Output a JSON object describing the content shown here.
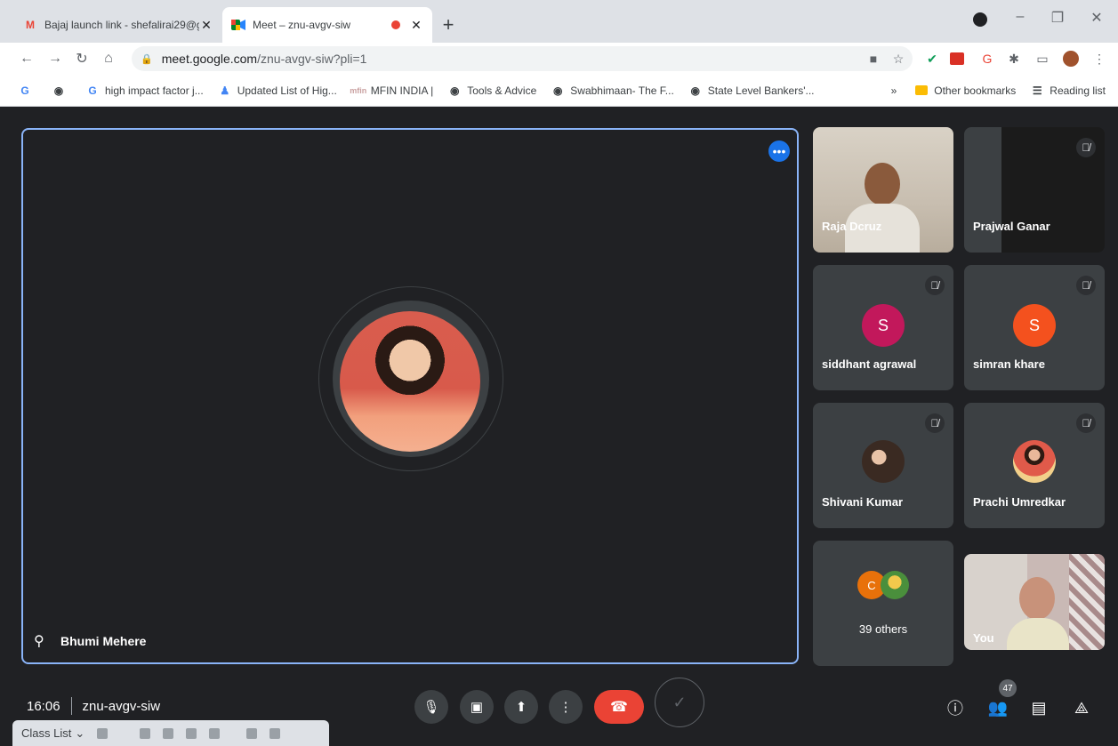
{
  "browser": {
    "tabs": [
      {
        "title": "Bajaj launch link - shefalirai29@g",
        "favicon": "gmail-icon",
        "close": "✕"
      },
      {
        "title": "Meet – znu-avgv-siw",
        "favicon": "meet-icon",
        "close": "✕"
      }
    ],
    "new_tab": "+",
    "url_host": "meet.google.com",
    "url_path": "/znu-avgv-siw?pli=1",
    "bookmarks": [
      {
        "label": "",
        "icon": "google-icon"
      },
      {
        "label": "",
        "icon": "globe-icon"
      },
      {
        "label": "high impact factor j...",
        "icon": "google-icon"
      },
      {
        "label": "Updated List of Hig...",
        "icon": "person-icon"
      },
      {
        "label": "MFIN INDIA |",
        "icon": "mfin-icon"
      },
      {
        "label": "Tools & Advice",
        "icon": "globe-icon"
      },
      {
        "label": "Swabhimaan- The F...",
        "icon": "globe-icon"
      },
      {
        "label": "State Level Bankers'...",
        "icon": "globe-icon"
      }
    ],
    "bookmarks_overflow": "»",
    "other_bookmarks": "Other bookmarks",
    "reading_list": "Reading list"
  },
  "meet": {
    "stage": {
      "name": "Bhumi Mehere"
    },
    "tiles": [
      {
        "name": "Raja Dcruz",
        "muted": false,
        "type": "video"
      },
      {
        "name": "Prajwal Ganar",
        "muted": true,
        "type": "video"
      },
      {
        "name": "siddhant agrawal",
        "muted": true,
        "type": "initial",
        "initial": "S",
        "color": "#c2185b"
      },
      {
        "name": "simran khare",
        "muted": true,
        "type": "initial",
        "initial": "S",
        "color": "#f4511e"
      },
      {
        "name": "Shivani Kumar",
        "muted": true,
        "type": "photo"
      },
      {
        "name": "Prachi Umredkar",
        "muted": true,
        "type": "photo"
      },
      {
        "name": "39 others",
        "type": "others",
        "initial": "C",
        "color": "#e8710a"
      },
      {
        "name": "You",
        "type": "video"
      }
    ],
    "time": "16:06",
    "meeting_code": "znu-avgv-siw",
    "participants_count": "47"
  },
  "taskbar": {
    "label": "Class List"
  }
}
